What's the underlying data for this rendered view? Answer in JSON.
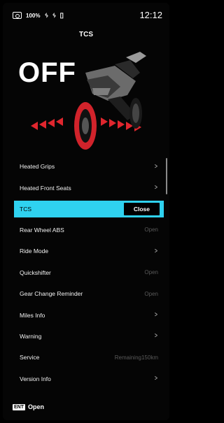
{
  "status_bar": {
    "battery": "100%",
    "icons": [
      "camera-icon",
      "rider-icon",
      "passenger-icon",
      "phone-icon"
    ],
    "time": "12:12"
  },
  "screen": {
    "title": "TCS",
    "state": "OFF"
  },
  "menu": {
    "items": [
      {
        "label": "Heated Grips",
        "value": "",
        "chevron": true
      },
      {
        "label": "Heated Front Seats",
        "value": "",
        "chevron": true
      },
      {
        "label": "TCS",
        "value": "Close",
        "active": true
      },
      {
        "label": "Rear Wheel ABS",
        "value": "Open"
      },
      {
        "label": "Ride Mode",
        "value": "",
        "chevron": true
      },
      {
        "label": "Quickshifter",
        "value": "Open"
      },
      {
        "label": "Gear Change Reminder",
        "value": "Open"
      },
      {
        "label": "Miles Info",
        "value": "",
        "chevron": true
      },
      {
        "label": "Warning",
        "value": "",
        "chevron": true
      },
      {
        "label": "Service",
        "value": "Remaining150km"
      },
      {
        "label": "Version Info",
        "value": "",
        "chevron": true
      }
    ],
    "chevron_glyph": ">"
  },
  "footer": {
    "key": "ENT",
    "action": "Open"
  },
  "colors": {
    "accent": "#2fd2f0",
    "arrow_red": "#e0262e",
    "background": "#000000"
  }
}
